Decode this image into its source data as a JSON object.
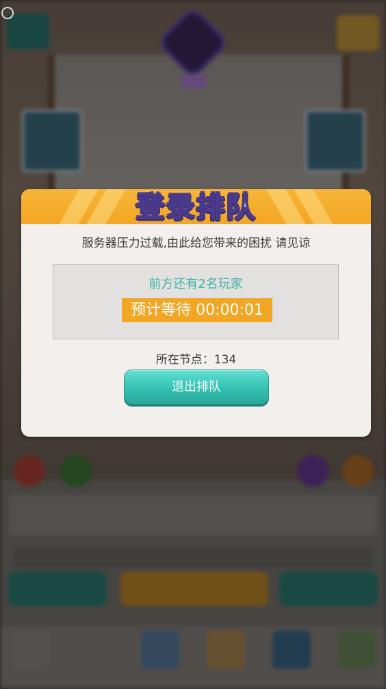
{
  "dialog": {
    "title": "登录排队",
    "message": "服务器压力过载,由此给您带来的困扰 请见谅",
    "queue_ahead": "前方还有2名玩家",
    "wait_label": "预计等待",
    "wait_time": "00:00:01",
    "node_label": "所在节点：",
    "node_value": "134",
    "exit_button": "退出排队"
  },
  "colors": {
    "header_orange": "#f3a623",
    "title_cyan": "#8cf3f6",
    "accent_teal": "#3fb3a7",
    "button_teal": "#34c1b3",
    "dialog_bg": "#f2efec"
  },
  "icons": [
    "app-logo-icon",
    "inventory-icon",
    "shop-icon",
    "weapon-card-icon",
    "armor-card-icon"
  ]
}
